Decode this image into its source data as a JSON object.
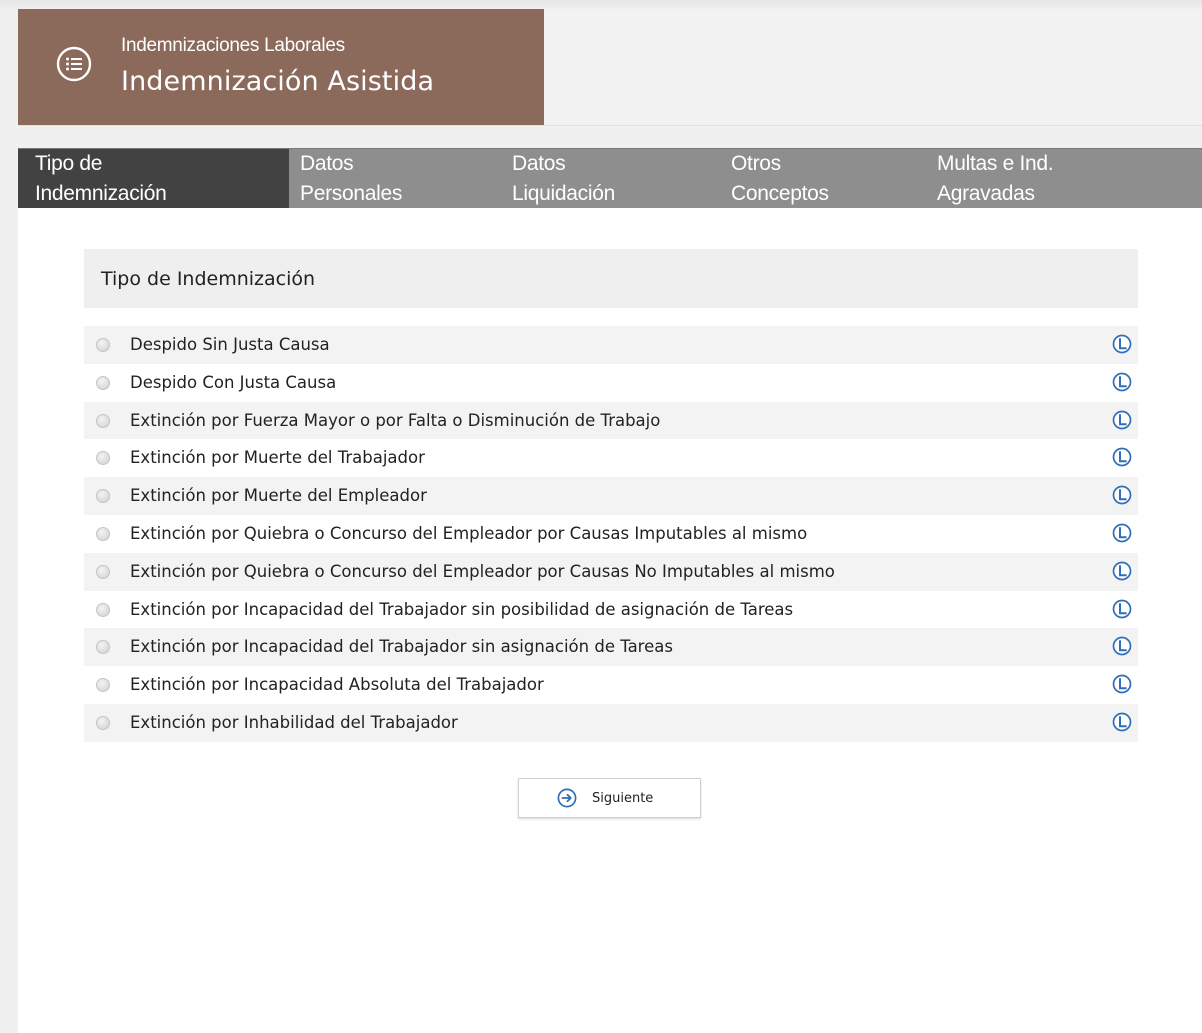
{
  "header": {
    "subtitle": "Indemnizaciones Laborales",
    "title": "Indemnización Asistida",
    "brand_color": "#8b6a5c",
    "icon": "list-icon"
  },
  "tabs": [
    {
      "line1": "Tipo de",
      "line2": "Indemnización",
      "active": true
    },
    {
      "line1": "Datos",
      "line2": "Personales",
      "active": false
    },
    {
      "line1": "Datos",
      "line2": "Liquidación",
      "active": false
    },
    {
      "line1": "Otros",
      "line2": "Conceptos",
      "active": false
    },
    {
      "line1": "Multas e Ind.",
      "line2": "Agravadas",
      "active": false
    }
  ],
  "section": {
    "title": "Tipo de Indemnización"
  },
  "options": [
    {
      "label": "Despido Sin Justa Causa",
      "selected": false
    },
    {
      "label": "Despido Con Justa Causa",
      "selected": false
    },
    {
      "label": "Extinción por Fuerza Mayor o por Falta o Disminución de Trabajo",
      "selected": false
    },
    {
      "label": "Extinción por Muerte del Trabajador",
      "selected": false
    },
    {
      "label": "Extinción por Muerte del Empleador",
      "selected": false
    },
    {
      "label": "Extinción por Quiebra o Concurso del Empleador por Causas Imputables al mismo",
      "selected": false
    },
    {
      "label": "Extinción por Quiebra o Concurso del Empleador por Causas No Imputables al mismo",
      "selected": false
    },
    {
      "label": "Extinción por Incapacidad del Trabajador sin posibilidad de asignación de Tareas",
      "selected": false
    },
    {
      "label": "Extinción por Incapacidad del Trabajador sin asignación de Tareas",
      "selected": false
    },
    {
      "label": "Extinción por Incapacidad Absoluta del Trabajador",
      "selected": false
    },
    {
      "label": "Extinción por Inhabilidad del Trabajador",
      "selected": false
    }
  ],
  "next_button": {
    "label": "Siguiente",
    "icon": "arrow-right-circle-icon"
  },
  "colors": {
    "accent": "#2e6fb7",
    "tab_bar": "#8e8e8e",
    "tab_active": "#424242"
  }
}
